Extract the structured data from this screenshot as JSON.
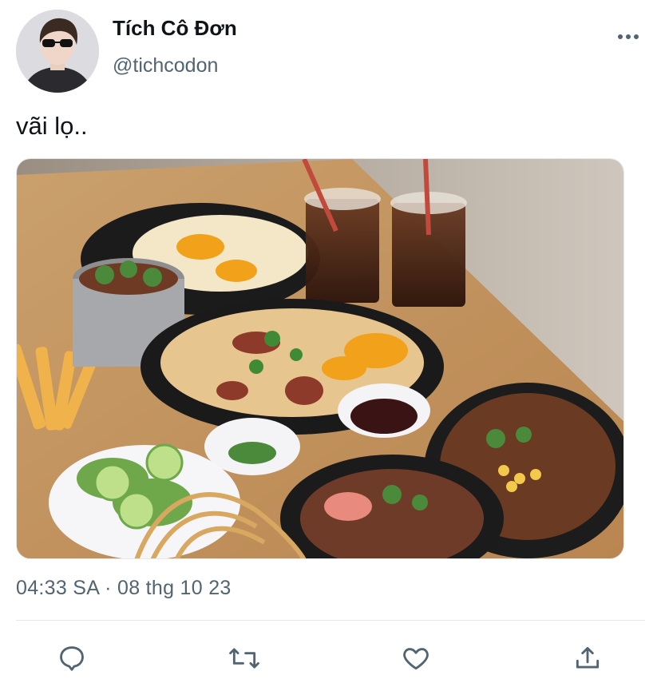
{
  "user": {
    "display_name": "Tích Cô Đơn",
    "handle": "@tichcodon",
    "avatar_icon": "avatar-photo"
  },
  "tweet": {
    "text": "vãi lọ..",
    "timestamp": "04:33 SA · 08 thg 10 23",
    "media": {
      "type": "photo",
      "content": "food-photo"
    }
  },
  "actions": [
    {
      "name": "reply",
      "icon": "comment-icon"
    },
    {
      "name": "retweet",
      "icon": "retweet-icon"
    },
    {
      "name": "like",
      "icon": "heart-icon"
    },
    {
      "name": "share",
      "icon": "share-icon"
    }
  ],
  "colors": {
    "text": "#0f1419",
    "secondary": "#536471",
    "divider": "#e6e9ec",
    "background": "#ffffff"
  }
}
